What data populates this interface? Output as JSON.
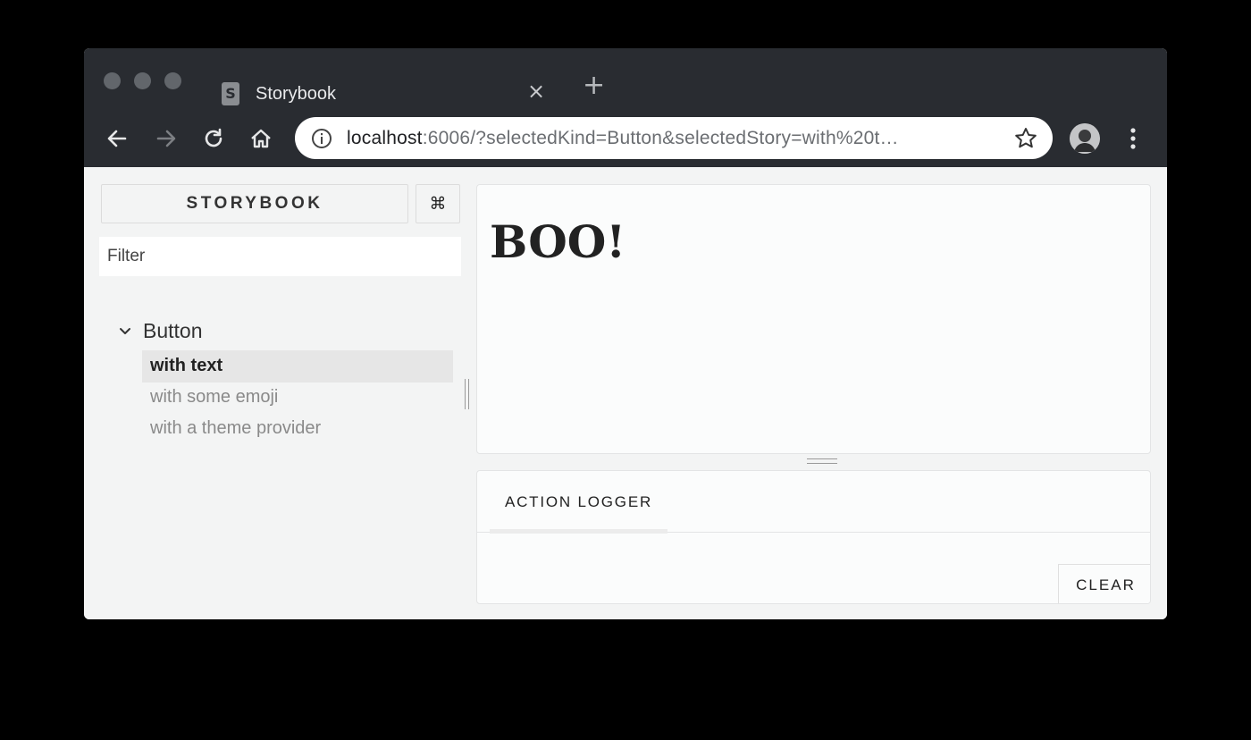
{
  "browser": {
    "tab_title": "Storybook",
    "tab_favicon": "S",
    "tab_close": "×",
    "new_tab": "+",
    "url_host": "localhost",
    "url_rest": ":6006/?selectedKind=Button&selectedStory=with%20t…"
  },
  "sidebar": {
    "brand": "STORYBOOK",
    "shortcut": "⌘",
    "filter_placeholder": "Filter",
    "kind": "Button",
    "stories": [
      {
        "label": "with text",
        "selected": true
      },
      {
        "label": "with some emoji",
        "selected": false
      },
      {
        "label": "with a theme provider",
        "selected": false
      }
    ]
  },
  "preview": {
    "text": "BOO!"
  },
  "addons": {
    "tab": "ACTION LOGGER",
    "clear": "CLEAR"
  },
  "colors": {
    "chrome": "#292c31",
    "content_bg": "#f3f4f4",
    "selected_story": "#e6e6e6"
  },
  "icons": [
    "storybook-favicon-icon",
    "close-tab-icon",
    "new-tab-icon",
    "back-arrow-icon",
    "forward-arrow-icon",
    "reload-icon",
    "home-icon",
    "site-info-icon",
    "star-icon",
    "profile-avatar",
    "menu-dots-icon",
    "chevron-down-icon"
  ]
}
